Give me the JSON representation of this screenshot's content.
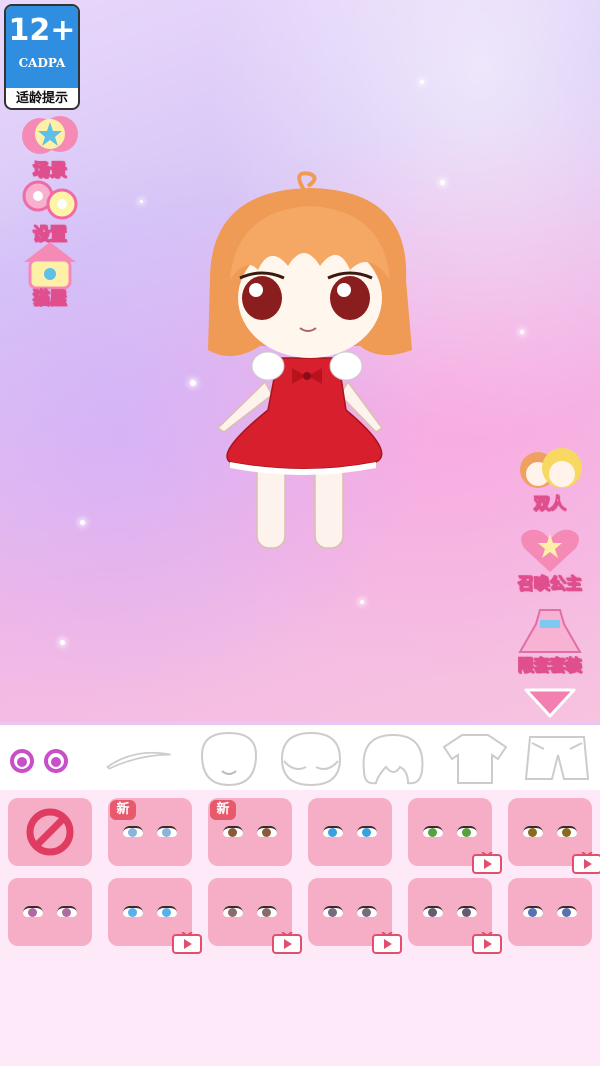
{
  "age_rating": {
    "number": "12+",
    "org": "CADPA",
    "tip": "适龄提示"
  },
  "left_menu": [
    {
      "label": "场景",
      "icon": "star-icon"
    },
    {
      "label": "设置",
      "icon": "gear-icon"
    },
    {
      "label": "猫屋",
      "icon": "cat-house-icon"
    }
  ],
  "right_menu": [
    {
      "label": "双人",
      "icon": "two-characters-icon"
    },
    {
      "label": "召唤公主",
      "icon": "summon-heart-icon"
    },
    {
      "label": "限套套装",
      "icon": "dress-icon"
    }
  ],
  "categories": [
    {
      "name": "eyes",
      "icon": "eyes-icon",
      "selected": true
    },
    {
      "name": "eyebrows",
      "icon": "eyebrow-icon"
    },
    {
      "name": "face",
      "icon": "face-icon"
    },
    {
      "name": "head",
      "icon": "head-icon"
    },
    {
      "name": "hair",
      "icon": "hair-icon"
    },
    {
      "name": "top",
      "icon": "shirt-icon"
    },
    {
      "name": "bottom",
      "icon": "pants-icon"
    }
  ],
  "items": [
    {
      "type": "none"
    },
    {
      "badge": "新",
      "iris": "#8ab4d8"
    },
    {
      "badge": "新",
      "iris": "#8a5a3a"
    },
    {
      "iris": "#3aa0e0"
    },
    {
      "iris": "#5aa040",
      "video": true
    },
    {
      "iris": "#8a6a20",
      "video": true
    },
    {
      "iris": "#b06aa0"
    },
    {
      "iris": "#5ab0e8",
      "video": true
    },
    {
      "iris": "#8a6a6a",
      "video": true
    },
    {
      "iris": "#7a6a80",
      "video": true
    },
    {
      "iris": "#6a5a70",
      "video": true
    },
    {
      "iris": "#5a70b0"
    }
  ],
  "colors": {
    "accent": "#e04f8d",
    "tile": "#f6aec6",
    "new_badge": "#e8596c"
  }
}
